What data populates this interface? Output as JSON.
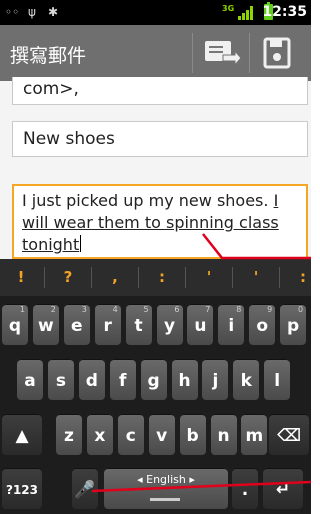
{
  "status": {
    "time": "12:35",
    "network": "3G"
  },
  "action_bar": {
    "title": "撰寫郵件"
  },
  "compose": {
    "to_tail": "com>,",
    "subject": "New shoes",
    "body_plain": "I just picked up my new shoes. ",
    "body_underlined": "I will wear them to spinning class tonight"
  },
  "suggestions": [
    "!",
    "?",
    ",",
    ":",
    "'",
    "'",
    ":"
  ],
  "keyboard": {
    "row1": [
      [
        "q",
        "1"
      ],
      [
        "w",
        "2"
      ],
      [
        "e",
        "3"
      ],
      [
        "r",
        "4"
      ],
      [
        "t",
        "5"
      ],
      [
        "y",
        "6"
      ],
      [
        "u",
        "7"
      ],
      [
        "i",
        "8"
      ],
      [
        "o",
        "9"
      ],
      [
        "p",
        "0"
      ]
    ],
    "row2": [
      "a",
      "s",
      "d",
      "f",
      "g",
      "h",
      "j",
      "k",
      "l"
    ],
    "row3": [
      "z",
      "x",
      "c",
      "v",
      "b",
      "n",
      "m"
    ],
    "sym_label": "?123",
    "language_label": "◂ English ▸"
  }
}
